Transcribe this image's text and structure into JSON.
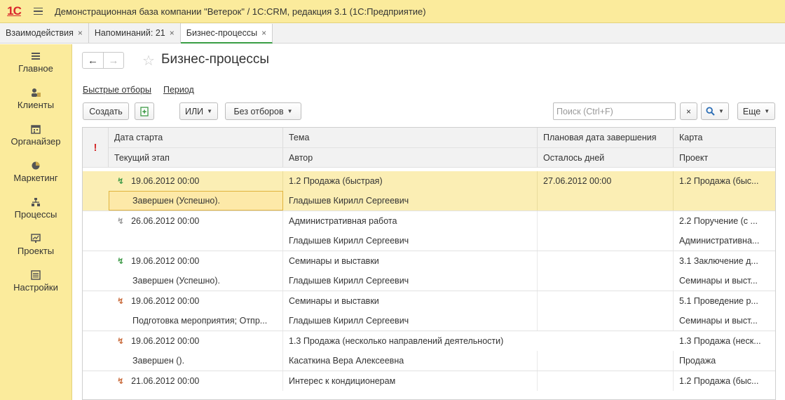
{
  "app": {
    "logo": "1С",
    "title": "Демонстрационная база компании \"Ветерок\" / 1С:CRM, редакция 3.1  (1С:Предприятие)"
  },
  "tabs": [
    {
      "label": "Взаимодействия",
      "close": "×"
    },
    {
      "label": "Напоминаний: 21",
      "close": "×"
    },
    {
      "label": "Бизнес-процессы",
      "close": "×",
      "active": true
    }
  ],
  "sidebar": {
    "items": [
      {
        "icon": "home-icon",
        "label": "Главное"
      },
      {
        "icon": "clients-icon",
        "label": "Клиенты"
      },
      {
        "icon": "calendar-icon",
        "label": "Органайзер"
      },
      {
        "icon": "marketing-icon",
        "label": "Маркетинг"
      },
      {
        "icon": "processes-icon",
        "label": "Процессы"
      },
      {
        "icon": "projects-icon",
        "label": "Проекты"
      },
      {
        "icon": "settings-icon",
        "label": "Настройки"
      }
    ]
  },
  "page": {
    "title": "Бизнес-процессы",
    "quick_filters": "Быстрые отборы",
    "period": "Период"
  },
  "toolbar": {
    "create": "Создать",
    "or": "ИЛИ",
    "no_filters": "Без отборов",
    "search_placeholder": "Поиск (Ctrl+F)",
    "clear": "×",
    "more": "Еще"
  },
  "table": {
    "headers": {
      "importance": "!",
      "start_date": "Дата старта",
      "topic": "Тема",
      "planned_end": "Плановая дата завершения",
      "map": "Карта",
      "current_stage": "Текущий этап",
      "author": "Автор",
      "days_left": "Осталось дней",
      "project": "Проект"
    },
    "rows": [
      {
        "start": "19.06.2012 00:00",
        "topic": "1.2 Продажа (быстрая)",
        "planned": "27.06.2012 00:00",
        "map": "1.2 Продажа (быс...",
        "stage": "Завершен (Успешно).",
        "author": "Гладышев Кирилл Сергеевич",
        "days": "",
        "project": ""
      },
      {
        "start": "26.06.2012 00:00",
        "topic": "Административная работа",
        "planned": "",
        "map": "2.2 Поручение  (с ...",
        "stage": "",
        "author": "Гладышев Кирилл Сергеевич",
        "days": "",
        "project": "Административна..."
      },
      {
        "start": "19.06.2012 00:00",
        "topic": "Семинары и выставки",
        "planned": "",
        "map": "3.1 Заключение д...",
        "stage": "Завершен (Успешно).",
        "author": "Гладышев Кирилл Сергеевич",
        "days": "",
        "project": "Семинары и выст..."
      },
      {
        "start": "19.06.2012 00:00",
        "topic": "Семинары и выставки",
        "planned": "",
        "map": "5.1 Проведение р...",
        "stage": "Подготовка мероприятия; Отпр...",
        "author": "Гладышев Кирилл Сергеевич",
        "days": "",
        "project": "Семинары и выст..."
      },
      {
        "start": "19.06.2012 00:00",
        "topic": "1.3 Продажа (несколько направлений деятельности)",
        "planned": "",
        "map": "1.3 Продажа (неск...",
        "stage": "Завершен ().",
        "author": "Касаткина Вера Алексеевна",
        "days": "",
        "project": "Продажа"
      },
      {
        "start": "21.06.2012 00:00",
        "topic": "Интерес к кондиционерам",
        "planned": "",
        "map": "1.2 Продажа (быс...",
        "stage": "",
        "author": "",
        "days": "",
        "project": ""
      }
    ]
  }
}
